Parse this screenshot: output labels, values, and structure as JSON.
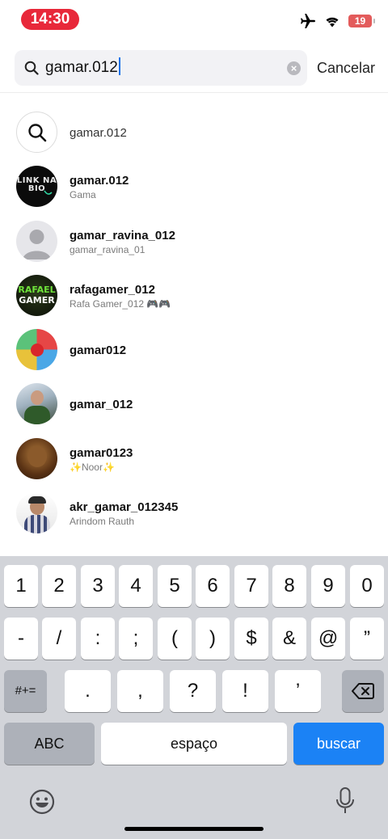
{
  "status": {
    "time": "14:30",
    "battery": "19"
  },
  "search": {
    "query": "gamar.012",
    "cancel": "Cancelar"
  },
  "results": [
    {
      "kind": "query",
      "name": "gamar.012",
      "sub": ""
    },
    {
      "kind": "user",
      "name": "gamar.012",
      "sub": "Gama",
      "avatar_text": "LINK NA BIO"
    },
    {
      "kind": "user",
      "name": "gamar_ravina_012",
      "sub": "gamar_ravina_01"
    },
    {
      "kind": "user",
      "name": "rafagamer_012",
      "sub": "Rafa Gamer_012 🎮🎮",
      "avatar_text": "RAFAEL GAMER"
    },
    {
      "kind": "user",
      "name": "gamar012",
      "sub": ""
    },
    {
      "kind": "user",
      "name": "gamar_012",
      "sub": ""
    },
    {
      "kind": "user",
      "name": "gamar0123",
      "sub": "✨Noor✨"
    },
    {
      "kind": "user",
      "name": "akr_gamar_012345",
      "sub": "Arindom Rauth"
    }
  ],
  "keyboard": {
    "row1": [
      "1",
      "2",
      "3",
      "4",
      "5",
      "6",
      "7",
      "8",
      "9",
      "0"
    ],
    "row2": [
      "-",
      "/",
      ":",
      ";",
      "(",
      ")",
      "$",
      "&",
      "@",
      "”"
    ],
    "row3_mode": "#+=",
    "row3": [
      ".",
      ",",
      "?",
      "!",
      "’"
    ],
    "abc": "ABC",
    "space": "espaço",
    "action": "buscar"
  },
  "colors": {
    "time_pill": "#e8283a",
    "action_key": "#1b82f5",
    "keyboard_bg": "#d2d4d9"
  }
}
